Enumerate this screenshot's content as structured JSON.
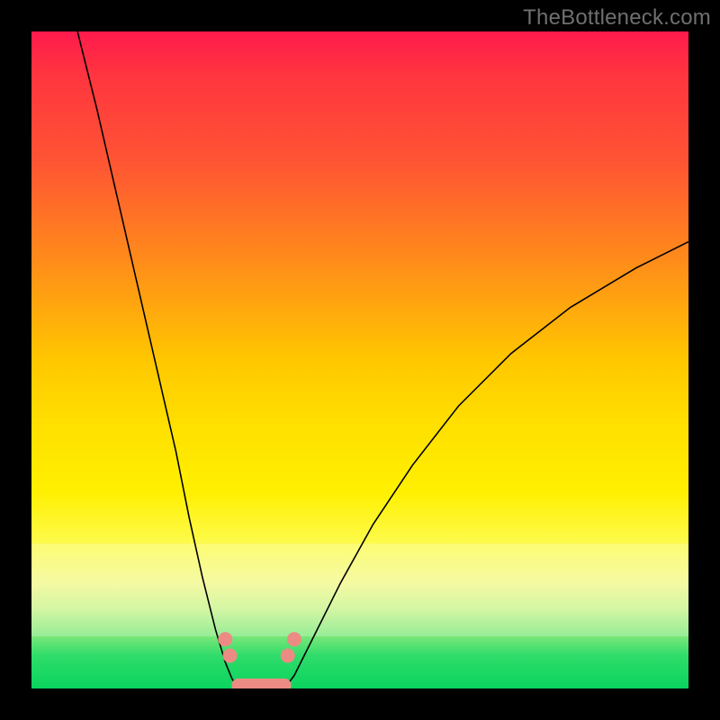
{
  "watermark": "TheBottleneck.com",
  "colors": {
    "background": "#000000",
    "gradient_top": "#ff1a4d",
    "gradient_mid": "#fff000",
    "gradient_bottom": "#09d45e",
    "marker": "#ec8b83",
    "curve": "#000000"
  },
  "chart_data": {
    "type": "line",
    "title": "",
    "xlabel": "",
    "ylabel": "",
    "xlim": [
      0,
      100
    ],
    "ylim": [
      0,
      100
    ],
    "series": [
      {
        "name": "left-branch",
        "x": [
          7,
          10,
          13,
          16,
          19,
          22,
          24,
          26,
          28,
          29.5,
          30.5,
          31.5
        ],
        "y": [
          100,
          88,
          75,
          62,
          49,
          36,
          26,
          17,
          9,
          4,
          1.5,
          0
        ]
      },
      {
        "name": "valley",
        "x": [
          31.5,
          33,
          35,
          37,
          38.5
        ],
        "y": [
          0,
          0,
          0,
          0,
          0
        ]
      },
      {
        "name": "right-branch",
        "x": [
          38.5,
          40,
          43,
          47,
          52,
          58,
          65,
          73,
          82,
          92,
          100
        ],
        "y": [
          0,
          2,
          8,
          16,
          25,
          34,
          43,
          51,
          58,
          64,
          68
        ]
      }
    ],
    "markers": [
      {
        "x": 29.5,
        "y": 7.5
      },
      {
        "x": 30.2,
        "y": 5.0
      },
      {
        "x": 39.0,
        "y": 5.0
      },
      {
        "x": 40.0,
        "y": 7.5
      }
    ],
    "marker_line": {
      "x1": 31.5,
      "y1": 0.5,
      "x2": 38.5,
      "y2": 0.5
    }
  }
}
